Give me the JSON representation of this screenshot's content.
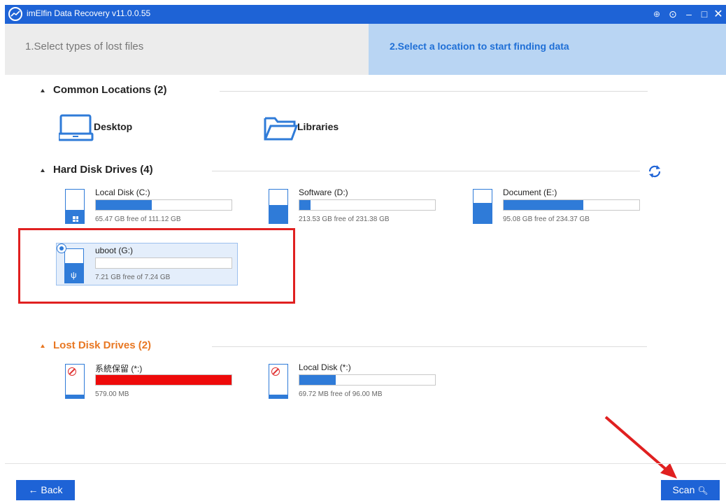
{
  "window": {
    "title": "imElfin Data Recovery v11.0.0.55",
    "controls": [
      "download-icon",
      "check-icon",
      "minimize-icon",
      "maximize-icon",
      "close-icon"
    ]
  },
  "steps": {
    "step1": "1.Select types of lost files",
    "step2": "2.Select a location to start finding data"
  },
  "common_locations": {
    "title": "Common Locations (2)",
    "items": [
      {
        "label": "Desktop",
        "icon": "laptop-icon"
      },
      {
        "label": "Libraries",
        "icon": "folder-icon"
      }
    ]
  },
  "hard_disk_drives": {
    "title": "Hard Disk Drives (4)",
    "drives": [
      {
        "name": "Local Disk (C:)",
        "info": "65.47 GB free of 111.12 GB",
        "used_fraction": 0.41
      },
      {
        "name": "Software (D:)",
        "info": "213.53 GB free of 231.38 GB",
        "used_fraction": 0.08
      },
      {
        "name": "Document (E:)",
        "info": "95.08 GB free of 234.37 GB",
        "used_fraction": 0.59
      },
      {
        "name": "uboot (G:)",
        "info": "7.21 GB free of 7.24 GB",
        "used_fraction": 0.0,
        "selected": true
      }
    ]
  },
  "lost_disk_drives": {
    "title": "Lost Disk Drives (2)",
    "drives": [
      {
        "name": "系統保留 (*:)",
        "info": "579.00 MB",
        "used_fraction": 1.0,
        "bar_color": "#ee0a0a"
      },
      {
        "name": "Local Disk (*:)",
        "info": "69.72 MB free of 96.00 MB",
        "used_fraction": 0.27
      }
    ]
  },
  "buttons": {
    "back": "← Back",
    "scan": "Scan"
  },
  "colors": {
    "accent": "#1e63d6",
    "drive_fill": "#2f7bd8",
    "lost_title": "#e87722",
    "highlight": "#e02020"
  }
}
